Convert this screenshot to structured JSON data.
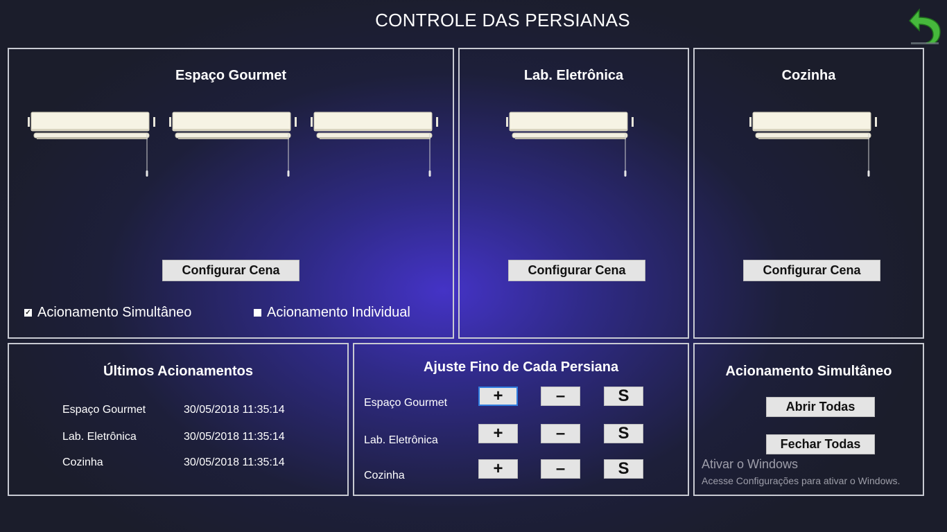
{
  "header": {
    "title": "CONTROLE DAS PERSIANAS",
    "back_icon": "undo-arrow-icon"
  },
  "rooms": [
    {
      "name": "Espaço Gourmet",
      "configure_label": "Configurar Cena"
    },
    {
      "name": "Lab. Eletrônica",
      "configure_label": "Configurar Cena"
    },
    {
      "name": "Cozinha",
      "configure_label": "Configurar Cena"
    }
  ],
  "mode": {
    "simultaneous_label": "Acionamento Simultâneo",
    "simultaneous_checked": true,
    "individual_label": "Acionamento Individual",
    "individual_checked": false
  },
  "log": {
    "title": "Últimos Acionamentos",
    "rows": [
      {
        "room": "Espaço Gourmet",
        "time": "30/05/2018 11:35:14"
      },
      {
        "room": "Lab. Eletrônica",
        "time": "30/05/2018 11:35:14"
      },
      {
        "room": "Cozinha",
        "time": "30/05/2018 11:35:14"
      }
    ]
  },
  "fine": {
    "title": "Ajuste Fino de Cada Persiana",
    "rows": [
      {
        "room": "Espaço Gourmet",
        "plus": "+",
        "minus": "–",
        "stop": "S"
      },
      {
        "room": "Lab. Eletrônica",
        "plus": "+",
        "minus": "–",
        "stop": "S"
      },
      {
        "room": "Cozinha",
        "plus": "+",
        "minus": "–",
        "stop": "S"
      }
    ]
  },
  "simultaneous": {
    "title": "Acionamento Simultâneo",
    "open_all": "Abrir Todas",
    "close_all": "Fechar Todas"
  },
  "watermark": {
    "line1": "Ativar o Windows",
    "line2": "Acesse Configurações para ativar o Windows."
  },
  "colors": {
    "accent_back": "#3aa63a",
    "fine_selected_border": "#2f7de0"
  }
}
